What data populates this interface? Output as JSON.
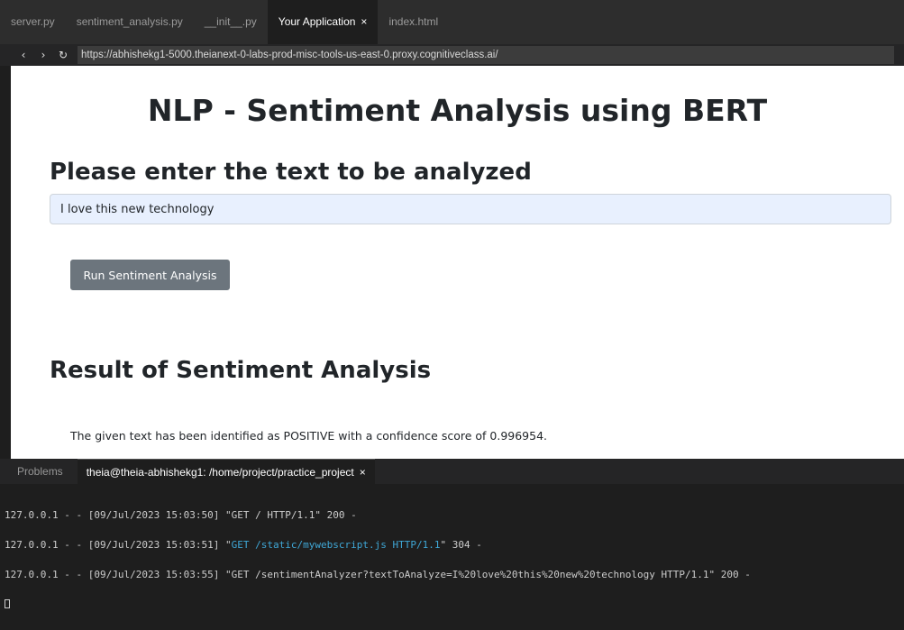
{
  "tabs": [
    {
      "label": "server.py",
      "active": false
    },
    {
      "label": "sentiment_analysis.py",
      "active": false
    },
    {
      "label": "__init__.py",
      "active": false
    },
    {
      "label": "Your Application",
      "active": true,
      "close": "×"
    },
    {
      "label": "index.html",
      "active": false
    }
  ],
  "nav": {
    "back": "‹",
    "forward": "›",
    "reload": "↻",
    "url": "https://abhishekg1-5000.theianext-0-labs-prod-misc-tools-us-east-0.proxy.cognitiveclass.ai/"
  },
  "page": {
    "title": "NLP - Sentiment Analysis using BERT",
    "prompt_heading": "Please enter the text to be analyzed",
    "input_value": "I love this new technology",
    "run_button": "Run Sentiment Analysis",
    "result_heading": "Result of Sentiment Analysis",
    "result_text": "The given text has been identified as POSITIVE with a confidence score of 0.996954."
  },
  "panel": {
    "problems_tab": "Problems",
    "terminal_tab": "theia@theia-abhishekg1: /home/project/practice_project",
    "terminal_close": "×",
    "lines": [
      {
        "pre": "127.0.0.1 - - [09/Jul/2023 15:03:50] \"GET / HTTP/1.1\" 200 -",
        "hl": "",
        "post": ""
      },
      {
        "pre": "127.0.0.1 - - [09/Jul/2023 15:03:51] \"",
        "hl": "GET /static/mywebscript.js HTTP/1.1",
        "post": "\" 304 -"
      },
      {
        "pre": "127.0.0.1 - - [09/Jul/2023 15:03:55] \"GET /sentimentAnalyzer?textToAnalyze=I%20love%20this%20new%20technology HTTP/1.1\" 200 -",
        "hl": "",
        "post": ""
      }
    ]
  },
  "colors": {
    "button": "#6c757d",
    "input_bg": "#e8f0fe",
    "terminal_highlight": "#3fa7d6"
  }
}
